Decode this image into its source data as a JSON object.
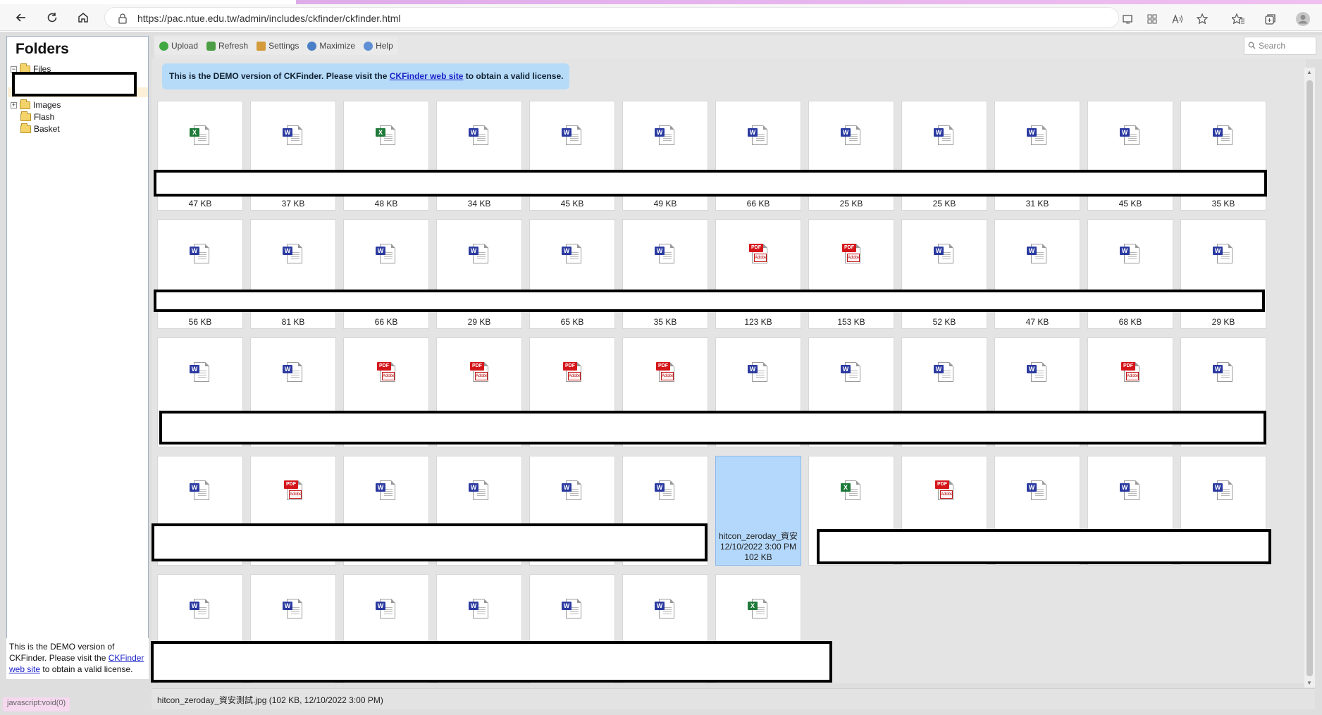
{
  "browser": {
    "url": "https://pac.ntue.edu.tw/admin/includes/ckfinder/ckfinder.html"
  },
  "sidebar": {
    "title": "Folders",
    "folders": [
      {
        "label": "Files",
        "expanded": true
      },
      {
        "label": "Images",
        "expanded": false
      },
      {
        "label": "Flash"
      },
      {
        "label": "Basket"
      }
    ],
    "footer_text_before": "This is the DEMO version of CKFinder. Please visit the ",
    "footer_link": "CKFinder web site",
    "footer_text_after": " to obtain a valid license.",
    "status_link": "javascript:void(0)"
  },
  "toolbar": {
    "upload": "Upload",
    "refresh": "Refresh",
    "settings": "Settings",
    "maximize": "Maximize",
    "help": "Help",
    "search_placeholder": "Search"
  },
  "banner": {
    "text_before": "This is the DEMO version of CKFinder. Please visit the ",
    "link": "CKFinder web site",
    "text_after": " to obtain a valid license."
  },
  "rows": [
    [
      {
        "type": "excel",
        "size": "47 KB"
      },
      {
        "type": "word",
        "size": "37 KB"
      },
      {
        "type": "excel",
        "size": "48 KB"
      },
      {
        "type": "word",
        "size": "34 KB"
      },
      {
        "type": "word",
        "size": "45 KB"
      },
      {
        "type": "word",
        "size": "49 KB"
      },
      {
        "type": "word",
        "size": "66 KB"
      },
      {
        "type": "word",
        "size": "25 KB"
      },
      {
        "type": "word",
        "size": "25 KB"
      },
      {
        "type": "word",
        "size": "31 KB"
      },
      {
        "type": "word",
        "size": "45 KB"
      },
      {
        "type": "word",
        "size": "35 KB"
      }
    ],
    [
      {
        "type": "word",
        "size": "56 KB"
      },
      {
        "type": "word",
        "size": "81 KB"
      },
      {
        "type": "word",
        "size": "66 KB"
      },
      {
        "type": "word",
        "size": "29 KB"
      },
      {
        "type": "word",
        "size": "65 KB"
      },
      {
        "type": "word",
        "size": "35 KB"
      },
      {
        "type": "pdf",
        "size": "123 KB"
      },
      {
        "type": "pdf",
        "size": "153 KB"
      },
      {
        "type": "word",
        "size": "52 KB"
      },
      {
        "type": "word",
        "size": "47 KB"
      },
      {
        "type": "word",
        "size": "68 KB"
      },
      {
        "type": "word",
        "size": "29 KB"
      }
    ],
    [
      {
        "type": "word",
        "size": ""
      },
      {
        "type": "word",
        "size": ""
      },
      {
        "type": "pdf",
        "size": ""
      },
      {
        "type": "pdf",
        "size": ""
      },
      {
        "type": "pdf",
        "size": ""
      },
      {
        "type": "pdf",
        "size": ""
      },
      {
        "type": "word",
        "size": ""
      },
      {
        "type": "word",
        "size": ""
      },
      {
        "type": "word",
        "size": ""
      },
      {
        "type": "word",
        "size": ""
      },
      {
        "type": "pdf",
        "size": ""
      },
      {
        "type": "word",
        "size": ""
      }
    ],
    [
      {
        "type": "word",
        "size": ""
      },
      {
        "type": "pdf",
        "size": ""
      },
      {
        "type": "word",
        "size": ""
      },
      {
        "type": "word",
        "size": ""
      },
      {
        "type": "word",
        "size": ""
      },
      {
        "type": "word",
        "size": ""
      },
      {
        "type": "image",
        "selected": true,
        "name": "hitcon_zeroday_資安",
        "date": "12/10/2022 3:00 PM",
        "size": "102 KB"
      },
      {
        "type": "excel",
        "size": ""
      },
      {
        "type": "pdf",
        "size": ""
      },
      {
        "type": "word",
        "size": ""
      },
      {
        "type": "word",
        "size": ""
      },
      {
        "type": "word",
        "size": ""
      }
    ],
    [
      {
        "type": "word",
        "size": ""
      },
      {
        "type": "word",
        "size": ""
      },
      {
        "type": "word",
        "size": ""
      },
      {
        "type": "word",
        "size": ""
      },
      {
        "type": "word",
        "size": ""
      },
      {
        "type": "word",
        "size": ""
      },
      {
        "type": "excel",
        "size": ""
      }
    ]
  ],
  "status_bar": "hitcon_zeroday_資安測試.jpg (102 KB, 12/10/2022 3:00 PM)"
}
